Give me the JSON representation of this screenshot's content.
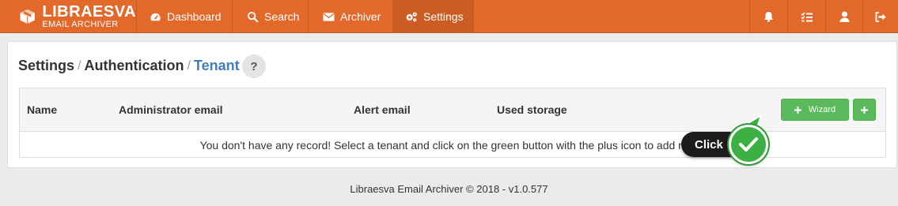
{
  "navbar": {
    "brand_name": "LIBRAESVA",
    "brand_sub": "EMAIL ARCHIVER",
    "items": [
      {
        "label": "Dashboard",
        "icon": "dashboard-icon"
      },
      {
        "label": "Search",
        "icon": "search-icon"
      },
      {
        "label": "Archiver",
        "icon": "envelope-icon"
      },
      {
        "label": "Settings",
        "icon": "gears-icon",
        "active": true
      }
    ],
    "right_icons": [
      "bell-icon",
      "tasks-icon",
      "user-icon",
      "sign-out-icon"
    ]
  },
  "breadcrumb": {
    "items": [
      "Settings",
      "Authentication",
      "Tenant"
    ],
    "separator": "/",
    "help_label": "?"
  },
  "table": {
    "columns": [
      "Name",
      "Administrator email",
      "Alert email",
      "Used storage"
    ],
    "wizard_label": "Wizard",
    "empty_message": "You don't have any record! Select a tenant and click on the green button with the plus icon to add new r"
  },
  "annotation": {
    "label": "Click"
  },
  "footer": {
    "text": "Libraesva Email Archiver © 2018 - v1.0.577"
  },
  "colors": {
    "navbar": "#e2692a",
    "accent_link": "#3f7fbf",
    "success": "#5cb85c"
  }
}
